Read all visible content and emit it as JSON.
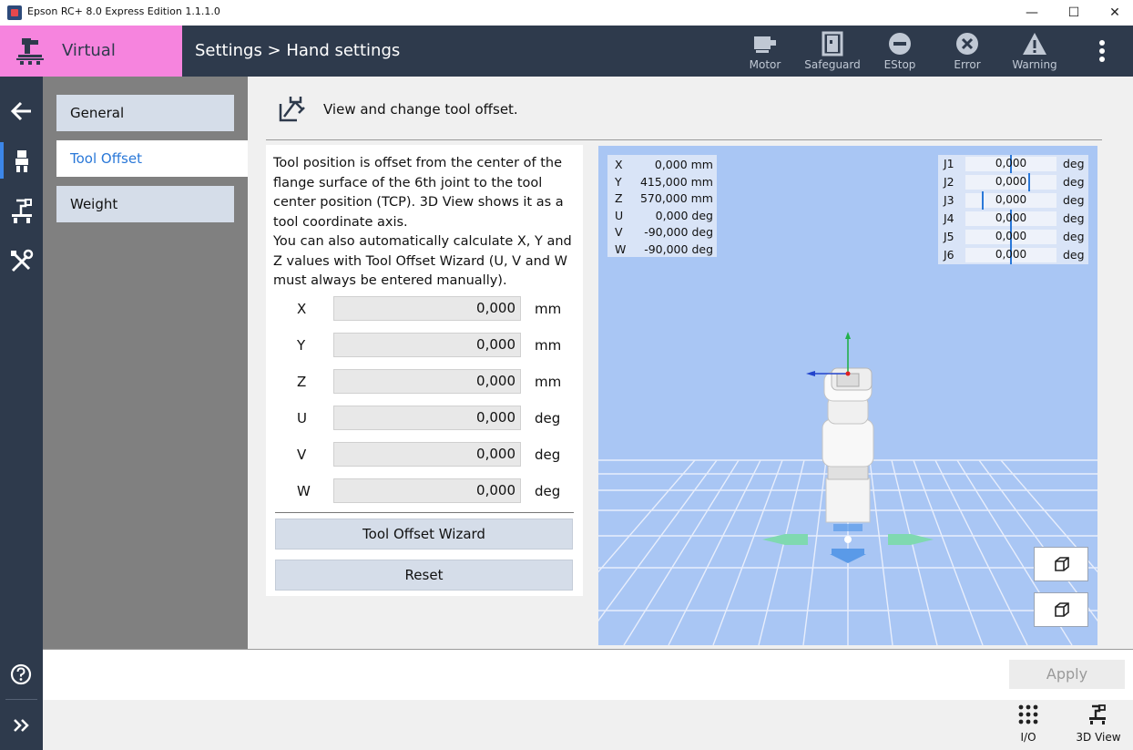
{
  "window": {
    "title": "Epson RC+ 8.0 Express Edition 1.1.1.0",
    "minimize": "—",
    "maximize": "☐",
    "close": "✕"
  },
  "header": {
    "mode": "Virtual",
    "breadcrumb": "Settings > Hand settings",
    "buttons": {
      "motor": "Motor",
      "safeguard": "Safeguard",
      "estop": "EStop",
      "error": "Error",
      "warning": "Warning"
    }
  },
  "nav": {
    "items": [
      "General",
      "Tool Offset",
      "Weight"
    ],
    "active": "Tool Offset"
  },
  "content": {
    "heading": "View and change tool offset.",
    "description": "Tool position is offset from the center of the flange surface of the 6th joint to the tool center position (TCP). 3D View shows it as a tool coordinate axis.\nYou can also automatically calculate X, Y and Z values with Tool Offset Wizard (U, V and W must always be entered manually).",
    "fields": [
      {
        "label": "X",
        "value": "0,000",
        "unit": "mm"
      },
      {
        "label": "Y",
        "value": "0,000",
        "unit": "mm"
      },
      {
        "label": "Z",
        "value": "0,000",
        "unit": "mm"
      },
      {
        "label": "U",
        "value": "0,000",
        "unit": "deg"
      },
      {
        "label": "V",
        "value": "0,000",
        "unit": "deg"
      },
      {
        "label": "W",
        "value": "0,000",
        "unit": "deg"
      }
    ],
    "wizard_button": "Tool Offset Wizard",
    "reset_button": "Reset"
  },
  "view3d": {
    "coords": [
      {
        "axis": "X",
        "value": "0,000 mm"
      },
      {
        "axis": "Y",
        "value": "415,000 mm"
      },
      {
        "axis": "Z",
        "value": "570,000 mm"
      },
      {
        "axis": "U",
        "value": "0,000 deg"
      },
      {
        "axis": "V",
        "value": "-90,000 deg"
      },
      {
        "axis": "W",
        "value": "-90,000 deg"
      }
    ],
    "joints": [
      {
        "name": "J1",
        "value": "0,000",
        "unit": "deg",
        "level": 0.5
      },
      {
        "name": "J2",
        "value": "0,000",
        "unit": "deg",
        "level": 0.7
      },
      {
        "name": "J3",
        "value": "0,000",
        "unit": "deg",
        "level": 0.19
      },
      {
        "name": "J4",
        "value": "0,000",
        "unit": "deg",
        "level": 0.5
      },
      {
        "name": "J5",
        "value": "0,000",
        "unit": "deg",
        "level": 0.5
      },
      {
        "name": "J6",
        "value": "0,000",
        "unit": "deg",
        "level": 0.5
      }
    ]
  },
  "footer": {
    "apply": "Apply",
    "io": "I/O",
    "view3d": "3D View"
  },
  "colors": {
    "header_bg": "#2e3a4c",
    "virtual_bg": "#f684de",
    "accent": "#2a78d8",
    "view_bg": "#a9c6f4"
  }
}
